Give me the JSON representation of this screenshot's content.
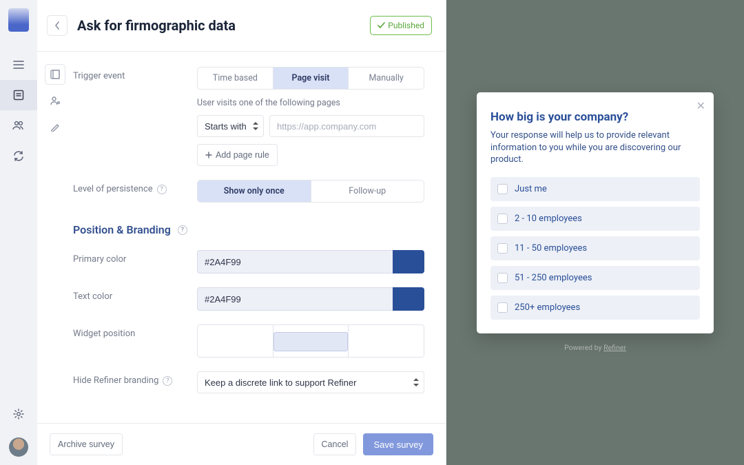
{
  "header": {
    "title": "Ask for firmographic data",
    "published_label": "Published"
  },
  "trigger": {
    "label": "Trigger event",
    "options": [
      "Time based",
      "Page visit",
      "Manually"
    ],
    "active_index": 1,
    "hint": "User visits one of the following pages",
    "match_type": "Starts with",
    "url_placeholder": "https://app.company.com",
    "add_rule_label": "Add page rule"
  },
  "persistence": {
    "label": "Level of persistence",
    "options": [
      "Show only once",
      "Follow-up"
    ],
    "active_index": 0
  },
  "branding": {
    "section_title": "Position & Branding",
    "primary_label": "Primary color",
    "primary_value": "#2A4F99",
    "text_label": "Text color",
    "text_value": "#2A4F99",
    "position_label": "Widget position",
    "hide_label": "Hide Refiner branding",
    "hide_value": "Keep a discrete link to support Refiner"
  },
  "footer": {
    "archive": "Archive survey",
    "cancel": "Cancel",
    "save": "Save survey"
  },
  "preview": {
    "question": "How big is your company?",
    "description": "Your response will help us to provide relevant information to you while you are discovering our product.",
    "options": [
      "Just me",
      "2 - 10 employees",
      "11 - 50 employees",
      "51 - 250 employees",
      "250+ employees"
    ],
    "powered_prefix": "Powered by ",
    "powered_link": "Refiner"
  }
}
